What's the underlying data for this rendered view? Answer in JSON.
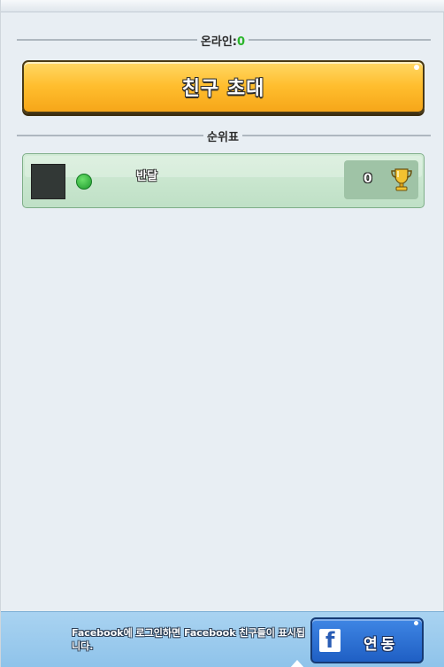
{
  "header": {
    "online_label": "온라인:",
    "online_count": "0"
  },
  "invite": {
    "label": "친구 초대"
  },
  "ranking": {
    "label": "순위표",
    "players": [
      {
        "name": "반달",
        "status": "online",
        "trophies": "0"
      }
    ]
  },
  "footer": {
    "message": "Facebook에 로그인하면 Facebook 친구들이 표시됩니다.",
    "connect_label": "연동",
    "connect_icon": "facebook-icon"
  },
  "colors": {
    "online_green": "#2bb52b",
    "invite_orange": "#ffbe2e",
    "row_green": "#bfe0c6",
    "facebook_blue": "#2a5db5",
    "footer_blue": "#9cccf0"
  }
}
